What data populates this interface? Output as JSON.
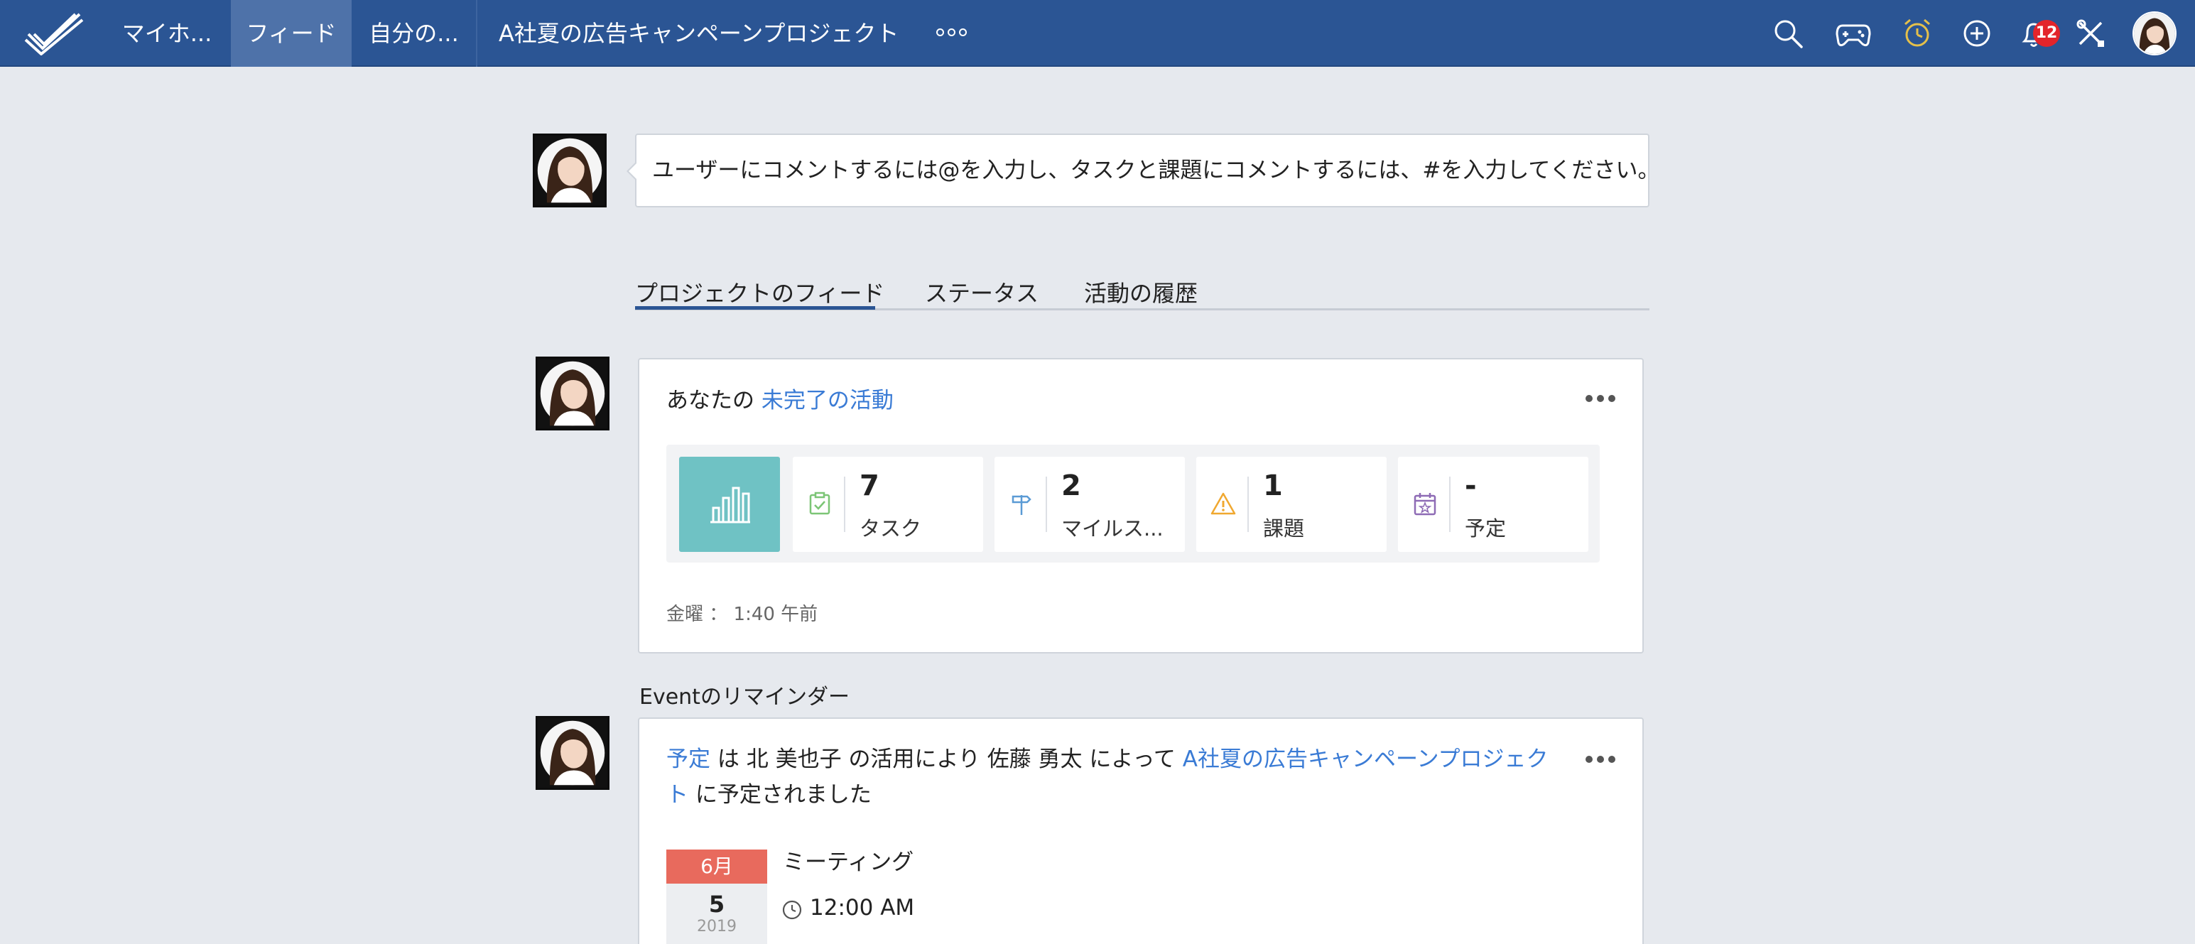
{
  "nav": {
    "items": [
      "マイホ...",
      "フィード",
      "自分の..."
    ],
    "active_index": 1,
    "project_title": "A社夏の広告キャンペーンプロジェクト",
    "notification_count": "12",
    "icons": [
      "search-icon",
      "gamepad-icon",
      "alarm-clock-icon",
      "add-circle-icon",
      "bell-icon",
      "tools-icon"
    ],
    "brand_color": "#2b5594"
  },
  "comment": {
    "prompt": "ユーザーにコメントするには@を入力し、タスクと課題にコメントするには、#を入力してください。"
  },
  "tabs": [
    "プロジェクトのフィード",
    "ステータス",
    "活動の履歴"
  ],
  "activity_card": {
    "title_prefix": "あなたの",
    "title_link": "未完了の活動",
    "stats": [
      {
        "value": "7",
        "label": "タスク",
        "icon": "task-check-icon",
        "color": "#7cc576"
      },
      {
        "value": "2",
        "label": "マイルス...",
        "icon": "milestone-sign-icon",
        "color": "#5b9bd5"
      },
      {
        "value": "1",
        "label": "課題",
        "icon": "warning-icon",
        "color": "#f0a830"
      },
      {
        "value": "-",
        "label": "予定",
        "icon": "calendar-star-icon",
        "color": "#8e6bb5"
      }
    ],
    "timestamp": "金曜 ： 1:40 午前"
  },
  "reminder_label": "Eventのリマインダー",
  "event_card": {
    "link_event": "予定",
    "t1": "は",
    "owner": "北 美也子",
    "t2": "の活用により",
    "user": "佐藤 勇太",
    "t3": "によって",
    "project_link_line1": "A社夏の広告キャンペーンプロジェク",
    "project_link_line2": "ト",
    "t4": "に予定されました",
    "event_title": "ミーティング",
    "time": "12:00 AM",
    "date": {
      "month": "6月",
      "day": "5",
      "year": "2019"
    }
  }
}
